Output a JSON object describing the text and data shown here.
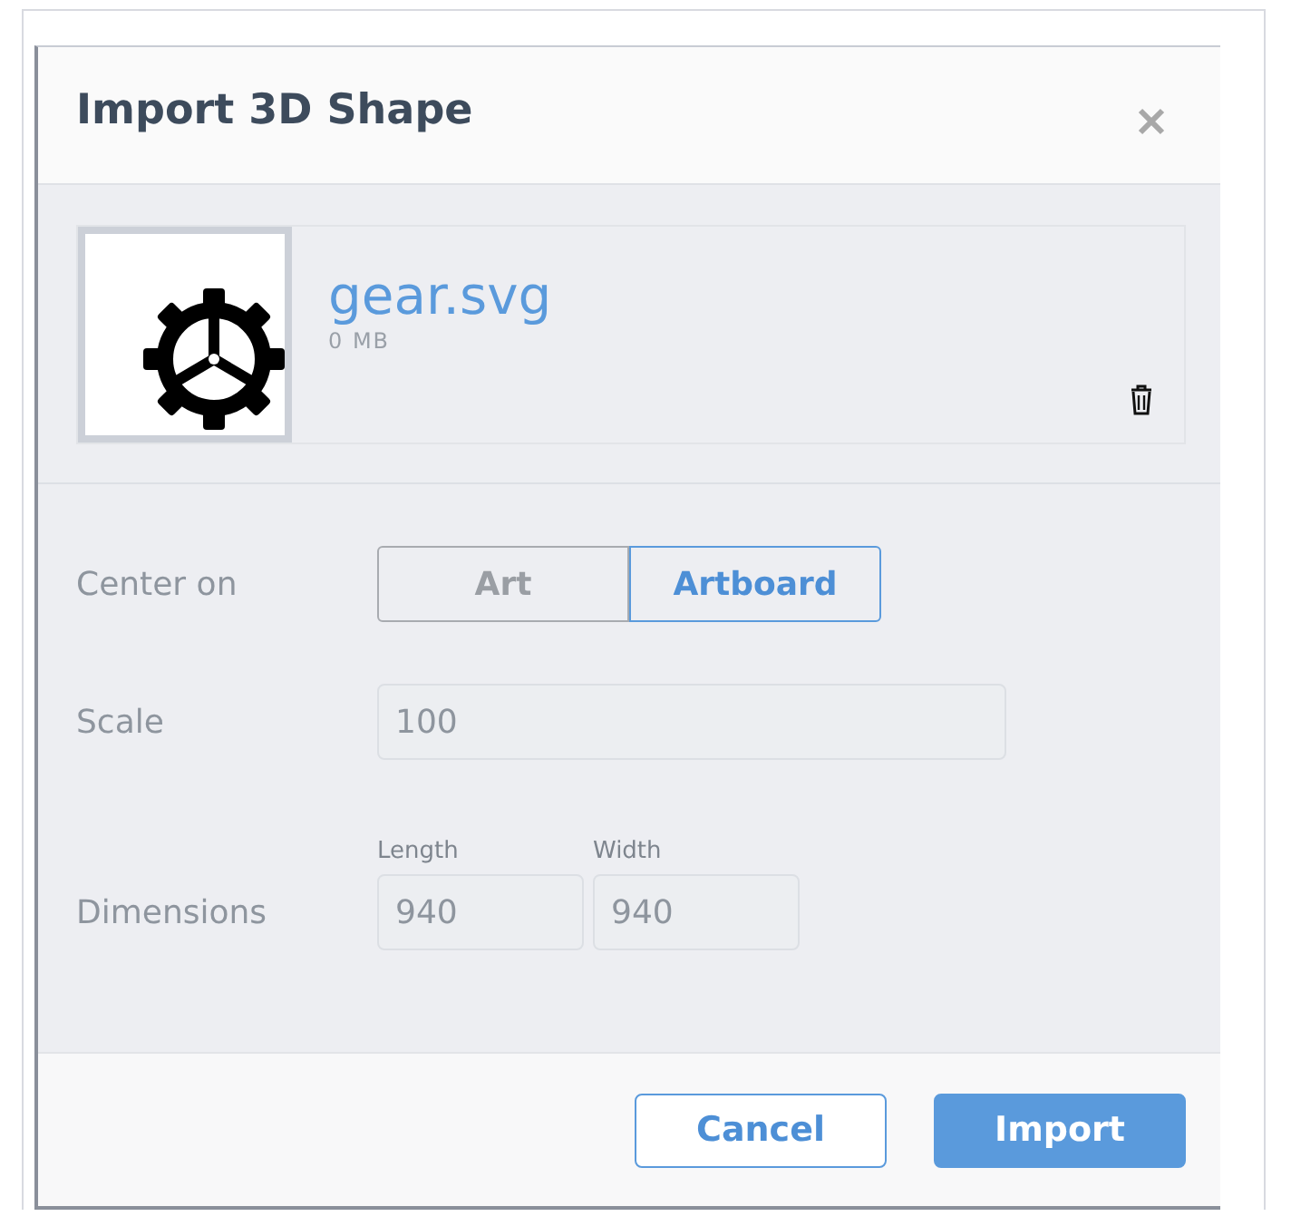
{
  "dialog": {
    "title": "Import 3D Shape"
  },
  "file": {
    "name": "gear.svg",
    "size": "0 MB"
  },
  "center_on": {
    "label": "Center on",
    "options": [
      {
        "label": "Art",
        "selected": false
      },
      {
        "label": "Artboard",
        "selected": true
      }
    ]
  },
  "scale": {
    "label": "Scale",
    "value": "100"
  },
  "dimensions": {
    "label": "Dimensions",
    "fields": [
      {
        "label": "Length",
        "value": "940"
      },
      {
        "label": "Width",
        "value": "940"
      }
    ]
  },
  "buttons": [
    {
      "label": "Cancel",
      "kind": "secondary"
    },
    {
      "label": "Import",
      "kind": "primary"
    }
  ]
}
